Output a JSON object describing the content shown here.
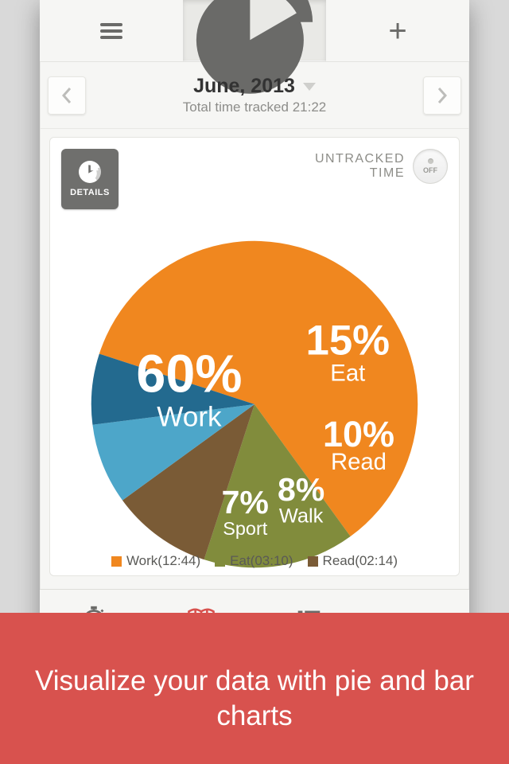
{
  "header": {
    "month_title": "June, 2013",
    "subtotal_label": "Total time tracked 21:22"
  },
  "details_label": "DETAILS",
  "untracked": {
    "line1": "UNTRACKED",
    "line2": "TIME",
    "toggle": "OFF"
  },
  "slices": {
    "work": {
      "pct": "60%",
      "name": "Work"
    },
    "eat": {
      "pct": "15%",
      "name": "Eat"
    },
    "read": {
      "pct": "10%",
      "name": "Read"
    },
    "walk": {
      "pct": "8%",
      "name": "Walk"
    },
    "sport": {
      "pct": "7%",
      "name": "Sport"
    }
  },
  "legend": {
    "work": "Work(12:44)",
    "eat": "Eat(03:10)",
    "read": "Read(02:14)"
  },
  "banner_text": "Visualize your data with pie and bar charts",
  "colors": {
    "work": "#f0871f",
    "eat": "#818c3c",
    "read": "#7a5b36",
    "walk": "#4da6c9",
    "sport": "#236a8f"
  },
  "chart_data": {
    "type": "pie",
    "title": "June, 2013",
    "subtitle": "Total time tracked 21:22",
    "series": [
      {
        "name": "Work",
        "percent": 60,
        "duration": "12:44",
        "color": "#f0871f"
      },
      {
        "name": "Eat",
        "percent": 15,
        "duration": "03:10",
        "color": "#818c3c"
      },
      {
        "name": "Read",
        "percent": 10,
        "duration": "02:14",
        "color": "#7a5b36"
      },
      {
        "name": "Walk",
        "percent": 8,
        "duration": null,
        "color": "#4da6c9"
      },
      {
        "name": "Sport",
        "percent": 7,
        "duration": null,
        "color": "#236a8f"
      }
    ],
    "untracked_time_shown": false
  }
}
